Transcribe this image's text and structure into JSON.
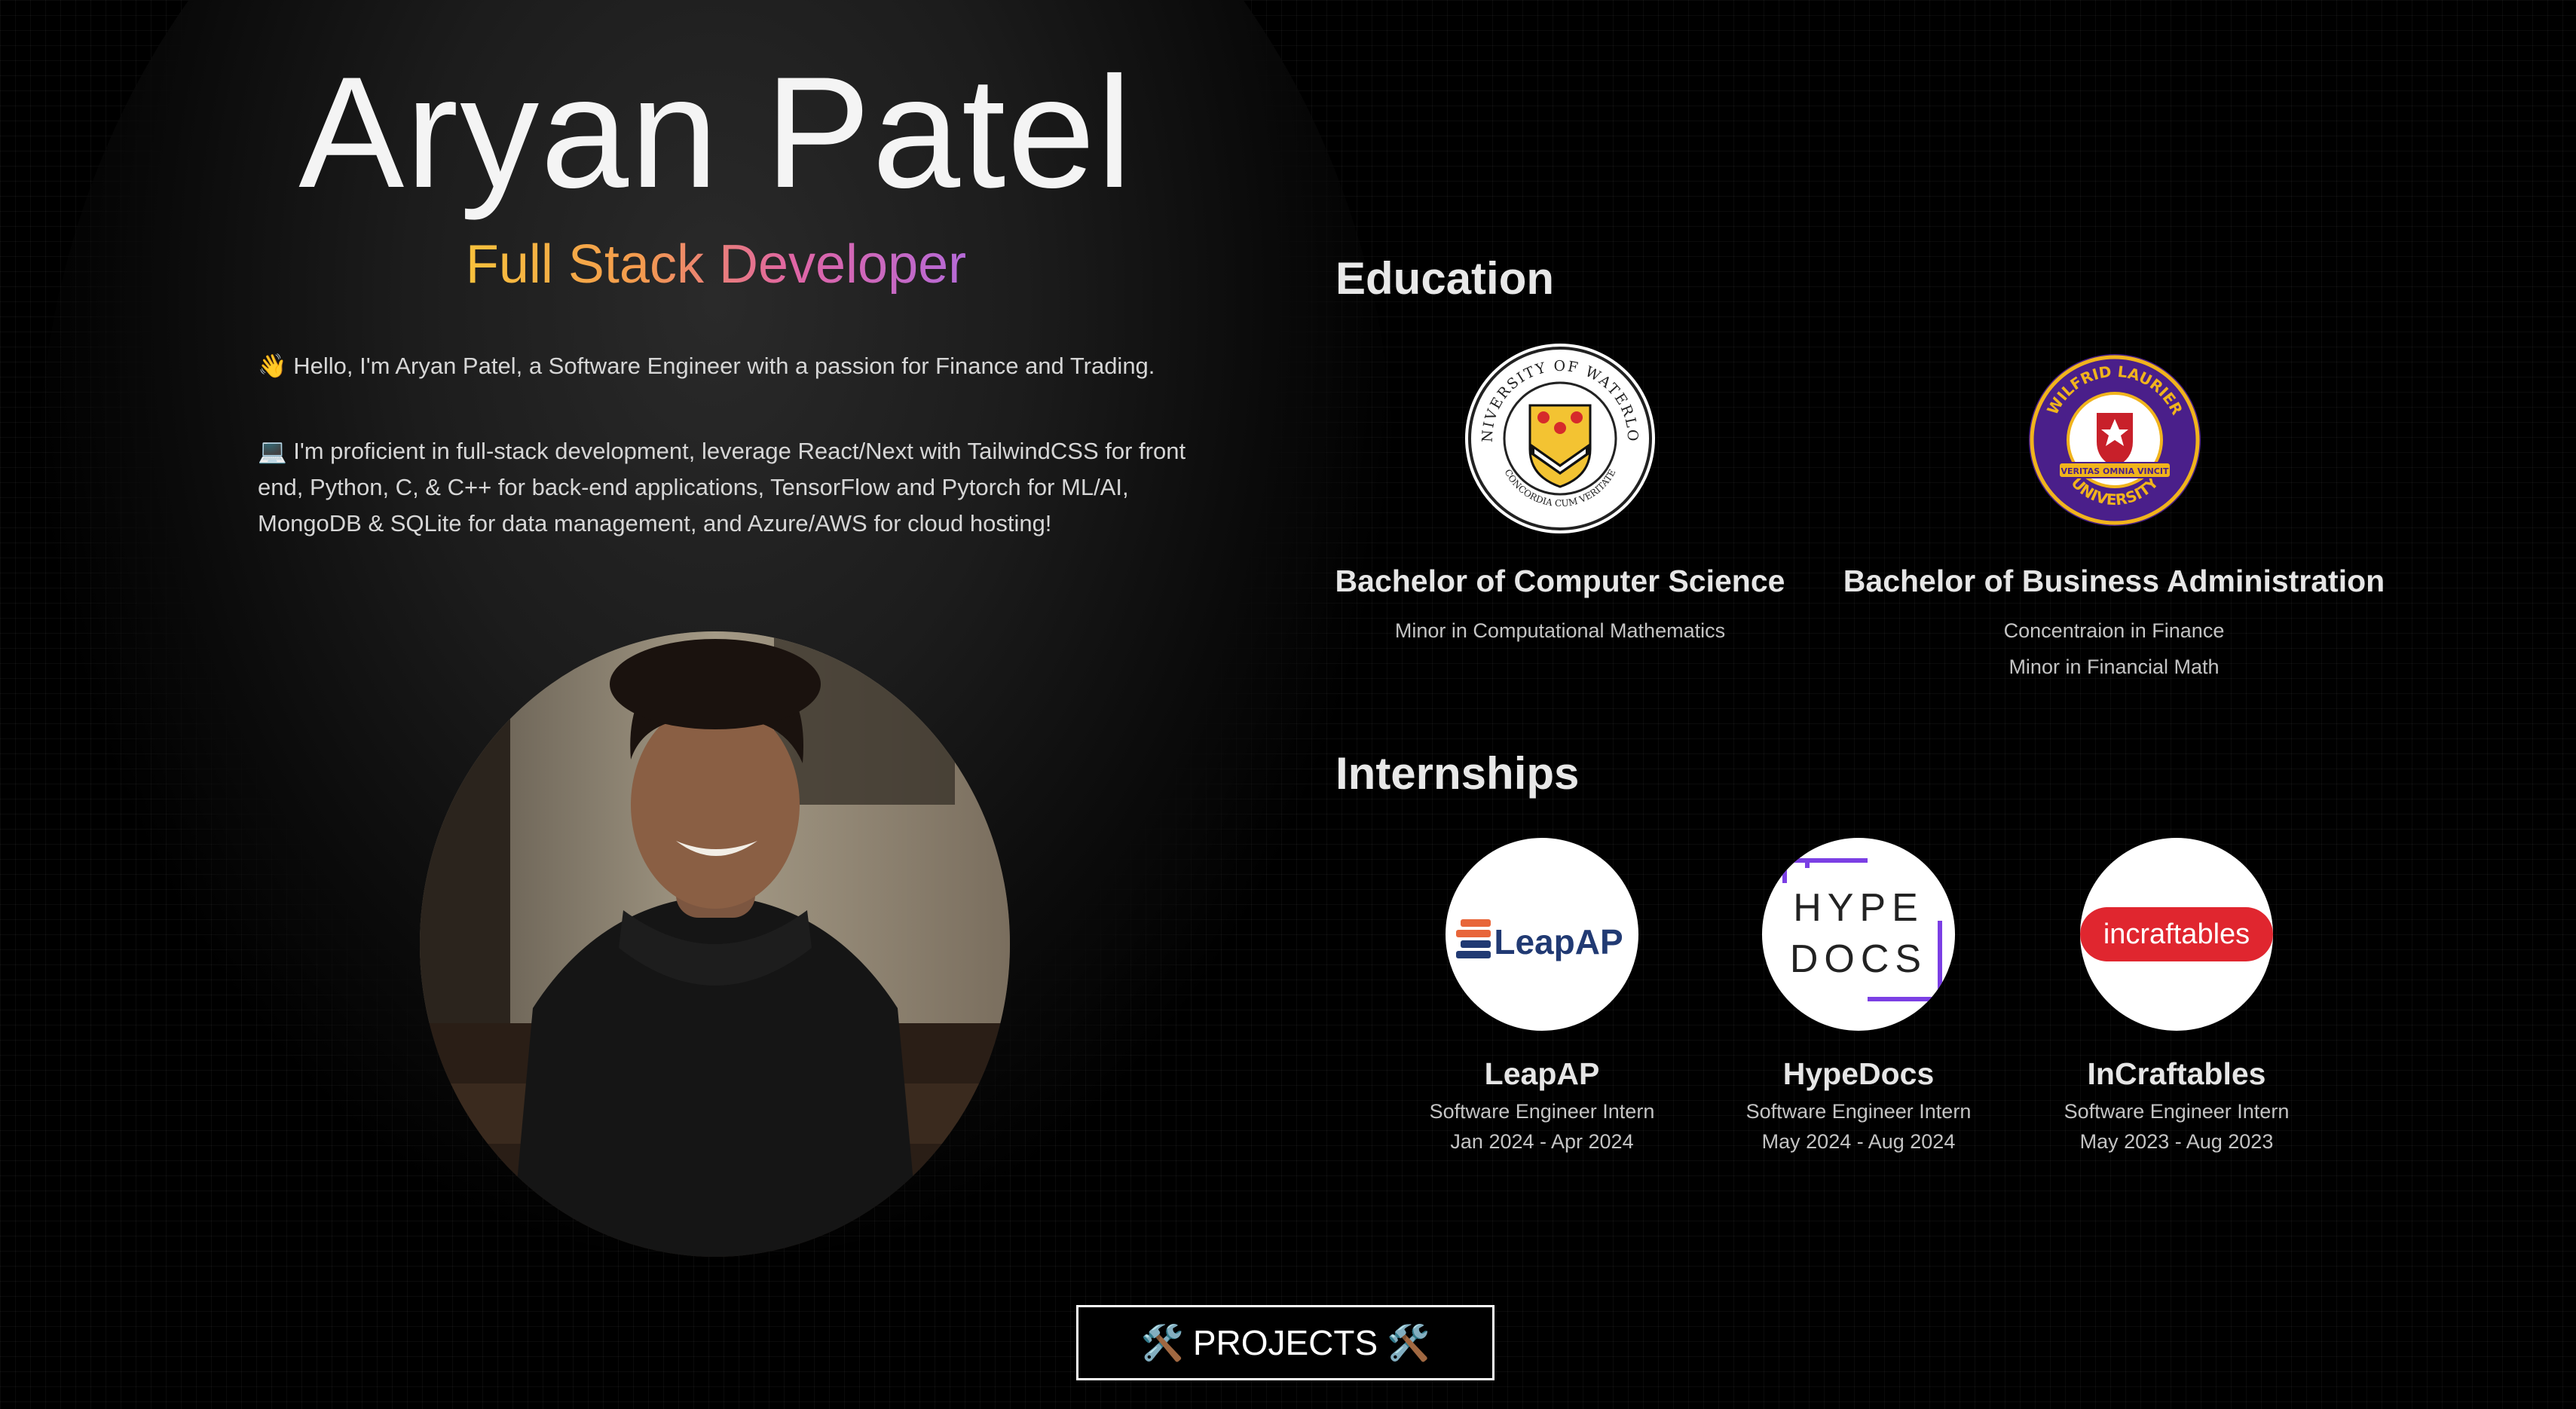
{
  "hero": {
    "name": "Aryan Patel",
    "role": "Full Stack Developer",
    "intro_1": "👋 Hello, I'm Aryan Patel, a Software Engineer with a passion for Finance and Trading.",
    "intro_2": "💻 I'm proficient in full-stack development, leverage React/Next with TailwindCSS for front end, Python, C, & C++ for back-end applications, TensorFlow and Pytorch for ML/AI, MongoDB & SQLite for data management, and Azure/AWS for cloud hosting!"
  },
  "education": {
    "title": "Education",
    "items": [
      {
        "logo_icon": "university-of-waterloo-crest",
        "logo_text_top": "UNIVERSITY OF WATERLOO",
        "logo_text_bottom": "CONCORDIA CUM VERITATE",
        "degree": "Bachelor of Computer Science",
        "details": [
          "Minor in Computational Mathematics"
        ]
      },
      {
        "logo_icon": "wilfrid-laurier-university-seal",
        "logo_text_top": "WILFRID LAURIER",
        "logo_text_bottom": "UNIVERSITY",
        "logo_text_banner": "VERITAS OMNIA VINCIT",
        "degree": "Bachelor of Business Administration",
        "details": [
          "Concentraion in Finance",
          "Minor in Financial Math"
        ]
      }
    ]
  },
  "internships": {
    "title": "Internships",
    "items": [
      {
        "logo_icon": "leapap-logo",
        "logo_text": "LeapAP",
        "company": "LeapAP",
        "role": "Software Engineer Intern",
        "dates": "Jan 2024 - Apr 2024"
      },
      {
        "logo_icon": "hypedocs-logo",
        "logo_text_1": "HYPE",
        "logo_text_2": "DOCS",
        "company": "HypeDocs",
        "role": "Software Engineer Intern",
        "dates": "May 2024 - Aug 2024"
      },
      {
        "logo_icon": "incraftables-logo",
        "logo_text": "incraftables",
        "company": "InCraftables",
        "role": "Software Engineer Intern",
        "dates": "May 2023 - Aug 2023"
      }
    ]
  },
  "projects_button": {
    "label": "PROJECTS",
    "icon": "hammer-and-wrench-icon"
  },
  "colors": {
    "background": "#000000",
    "gradient": [
      "#f9c23c",
      "#f39a4e",
      "#e065a4",
      "#b56ad8"
    ],
    "waterloo_red": "#d62b2b",
    "laurier_purple": "#4a1f8a",
    "laurier_gold": "#f1b41c",
    "incraftables_red": "#e0262f",
    "leapap_orange": "#e8663a",
    "leapap_navy": "#213a73",
    "hypedocs_purple": "#7b3fe4"
  }
}
